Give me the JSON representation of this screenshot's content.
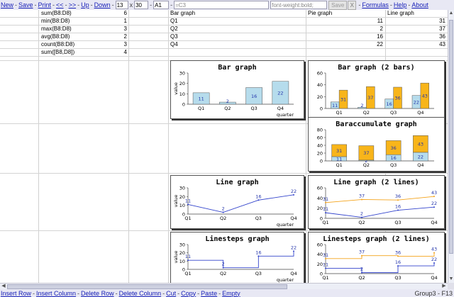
{
  "toolbar": {
    "new": "New",
    "save": "Save",
    "print": "Print",
    "first": "<<",
    "last": ">>",
    "up": "Up",
    "down": "Down",
    "rows": "13",
    "times": "x",
    "cols": "30",
    "cell": "A1",
    "formula": "=C3",
    "style": "font-weight:bold;",
    "save_button": "Save",
    "close_button": "X",
    "formulas": "Formulas",
    "help": "Help",
    "about": "About",
    "sep": "-"
  },
  "sheet": {
    "formulas": [
      {
        "label": "sum(B8:D8)",
        "value": "6"
      },
      {
        "label": "min(B8:D8)",
        "value": "1"
      },
      {
        "label": "max(B8:D8)",
        "value": "3"
      },
      {
        "label": "avg(B8:D8)",
        "value": "2"
      },
      {
        "label": "count(B8:D8)",
        "value": "3"
      },
      {
        "label": "sum([B8,D8])",
        "value": "4"
      }
    ],
    "headers": [
      "Bar graph",
      "Pie graph",
      "Line graph"
    ],
    "rows": [
      {
        "q": "Q1",
        "pie": "11",
        "line": "31"
      },
      {
        "q": "Q2",
        "pie": "2",
        "line": "37"
      },
      {
        "q": "Q3",
        "pie": "16",
        "line": "36"
      },
      {
        "q": "Q4",
        "pie": "22",
        "line": "43"
      }
    ]
  },
  "colors": {
    "series1": "#3344cc",
    "series2": "#f4a31a",
    "bar1": "#b6dcec",
    "bar2": "#f8b51a"
  },
  "chart_data": [
    {
      "type": "bar",
      "title": "Bar graph",
      "categories": [
        "Q1",
        "Q2",
        "Q3",
        "Q4"
      ],
      "series": [
        {
          "values": [
            11,
            2,
            16,
            22
          ]
        }
      ],
      "ylabel": "value",
      "xlabel": "quarter",
      "ylim": [
        0,
        30
      ],
      "yticks": [
        0,
        10,
        20,
        30
      ]
    },
    {
      "type": "bar",
      "title": "Bar graph (2 bars)",
      "categories": [
        "Q1",
        "Q2",
        "Q3",
        "Q4"
      ],
      "series": [
        {
          "values": [
            11,
            2,
            16,
            22
          ]
        },
        {
          "values": [
            31,
            37,
            36,
            43
          ]
        }
      ],
      "ylim": [
        0,
        60
      ],
      "yticks": [
        0,
        20,
        40,
        60
      ]
    },
    {
      "type": "bar",
      "stacked": true,
      "title": "Baraccumulate graph",
      "categories": [
        "Q1",
        "Q2",
        "Q3",
        "Q4"
      ],
      "series": [
        {
          "values": [
            11,
            2,
            16,
            22
          ]
        },
        {
          "values": [
            31,
            37,
            36,
            43
          ]
        }
      ],
      "ylim": [
        0,
        80
      ],
      "yticks": [
        0,
        20,
        40,
        60,
        80
      ]
    },
    {
      "type": "line",
      "title": "Line graph",
      "categories": [
        "Q1",
        "Q2",
        "Q3",
        "Q4"
      ],
      "series": [
        {
          "values": [
            11,
            2,
            16,
            22
          ]
        }
      ],
      "ylabel": "value",
      "xlabel": "quarter",
      "ylim": [
        0,
        30
      ],
      "yticks": [
        0,
        10,
        20,
        30
      ]
    },
    {
      "type": "line",
      "title": "Line graph (2 lines)",
      "categories": [
        "Q1",
        "Q2",
        "Q3",
        "Q4"
      ],
      "series": [
        {
          "values": [
            11,
            2,
            16,
            22
          ]
        },
        {
          "values": [
            31,
            37,
            36,
            43
          ]
        }
      ],
      "ylim": [
        0,
        60
      ],
      "yticks": [
        0,
        20,
        40,
        60
      ]
    },
    {
      "type": "line",
      "step": true,
      "title": "Linesteps graph",
      "categories": [
        "Q1",
        "Q2",
        "Q3",
        "Q4"
      ],
      "series": [
        {
          "values": [
            11,
            2,
            16,
            22
          ]
        }
      ],
      "ylabel": "value",
      "xlabel": "quarter",
      "ylim": [
        0,
        30
      ],
      "yticks": [
        0,
        10,
        20,
        30
      ]
    },
    {
      "type": "line",
      "step": true,
      "title": "Linesteps graph (2 lines)",
      "categories": [
        "Q1",
        "Q2",
        "Q3",
        "Q4"
      ],
      "series": [
        {
          "values": [
            11,
            2,
            16,
            22
          ]
        },
        {
          "values": [
            31,
            37,
            36,
            43
          ]
        }
      ],
      "ylim": [
        0,
        60
      ],
      "yticks": [
        0,
        20,
        40,
        60
      ]
    }
  ],
  "bottom": {
    "insert_row": "Insert Row",
    "insert_column": "Insert Column",
    "delete_row": "Delete Row",
    "delete_column": "Delete Column",
    "cut": "Cut",
    "copy": "Copy",
    "paste": "Paste",
    "empty": "Empty",
    "sep": "-",
    "status": "Group3 - F13"
  }
}
